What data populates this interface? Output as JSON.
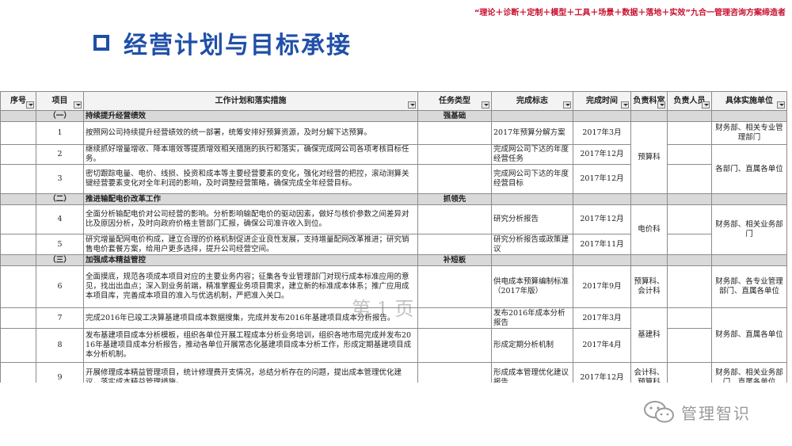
{
  "header": {
    "tagline": "“理论＋诊断＋定制＋模型＋工具＋场景＋数据＋落地＋实效”九合一管理咨询方案缔造者",
    "title": "经营计划与目标承接"
  },
  "table": {
    "columns": [
      "序号",
      "项目",
      "工作计划和落实措施",
      "任务类型",
      "完成标志",
      "完成时间",
      "负责科室",
      "负责人员",
      "具体实施单位"
    ],
    "sections": [
      {
        "index": "（一）",
        "title": "持续提升经营绩效",
        "type": "强基础",
        "rows": [
          {
            "no": "1",
            "measure": "按照网公司持续提升经营绩效的统一部署，统筹安排好预算资源，及时分解下达预算。",
            "flag": "2017年预算分解方案",
            "time": "2017年3月"
          },
          {
            "no": "2",
            "measure": "继续抓好增量增收、降本增效等提质增效相关措施的执行和落实，确保完成网公司各项考核目标任务。",
            "flag": "完成网公司下达的年度经营任务",
            "time": "2017年12月"
          },
          {
            "no": "3",
            "measure": "密切跟踪电量、电价、线损、投资和成本等主要经营要素的变化，强化对经营的把控，滚动测算关键经营要素变化对全年利润的影响，及时调整经营策略，确保完成全年经营目标。",
            "flag": "完成网公司下达的年度经营目标",
            "time": "2017年12月"
          }
        ],
        "depts": [
          "预算科"
        ],
        "units": [
          "财务部、相关专业管理部门",
          "各部门、直属各单位"
        ]
      },
      {
        "index": "（二）",
        "title": "推进输配电价改革工作",
        "type": "抓领先",
        "rows": [
          {
            "no": "4",
            "measure": "全面分析输配电价对公司经营的影响。分析影响输配电价的驱动因素，做好与核价参数之间差异对比及原因分析，及时向政府价格主管部门汇报，确保公司准许收入到位。",
            "flag": "研究分析报告",
            "time": "2017年12月"
          },
          {
            "no": "5",
            "measure": "研究增量配网电价构成，建立合理的价格机制促进企业良性发展，支持增量配网改革推进；研究销售电价套餐方案，给用户更多选择，提升公司经营空间。",
            "flag": "研究分析报告或政策建议",
            "time": "2017年11月"
          }
        ],
        "depts": [
          "电价科"
        ],
        "units": [
          "财务部、相关业务部门"
        ]
      },
      {
        "index": "（三）",
        "title": "加强成本精益管控",
        "type": "补短板",
        "rows": [
          {
            "no": "6",
            "measure": "全面摸底，规范各项成本项目对应的主要业务内容；征集各专业管理部门对现行成本标准应用的意见，找出出血点；深入到业务前端，精准掌握业务项目需求，建立新的标准成本体系；推广应用成本项目库，完善成本项目的准入与优选机制，严把准入关口。",
            "flag": "供电成本预算编制标准（2017年版）",
            "time": "2017年9月"
          },
          {
            "no": "7",
            "measure": "完成2016年已竣工决算基建项目成本数据搜集，完成并发布2016年基建项目成本分析报告。",
            "flag": "发布2016年成本分析报告",
            "time": "2017年3月"
          },
          {
            "no": "8",
            "measure": "发布基建项目成本分析模板，组织各单位开展工程成本分析业务培训，组织各地市局完成并发布2016年基建项目成本分析报告，推动各单位开展常态化基建项目成本分析工作，形成定期基建项目成本分析机制。",
            "flag": "形成定期分析机制",
            "time": "2017年4月"
          },
          {
            "no": "9",
            "measure": "开展修理成本精益管理项目，统计修理费开支情况，总结分析存在的问题，提出成本管理优化建议，落实成本精益管理措施。",
            "flag": "形成成本管理优化建议报告",
            "time": "2017年12月"
          }
        ],
        "depts": [
          "预算科、会计科",
          "基建科",
          "会计科、预算科"
        ],
        "units": [
          "财务部、各专业管理部门、直属各单位",
          "财务部、直属各单位",
          "财务部、相关业务部门、直属各单位"
        ]
      }
    ]
  },
  "watermark": "第 1 页",
  "brand": {
    "icon": "wechat-icon",
    "name": "管理智识"
  }
}
